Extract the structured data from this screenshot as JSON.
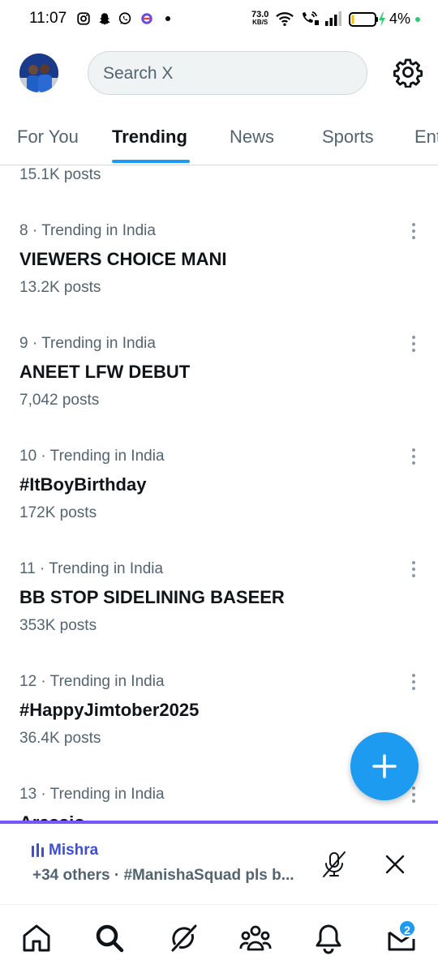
{
  "status_bar": {
    "time": "11:07",
    "net_speed_value": "73.0",
    "net_speed_unit": "KB/S",
    "battery": "4%",
    "notification_icons": [
      "instagram-icon",
      "snapchat-icon",
      "whatsapp-icon",
      "app-icon"
    ]
  },
  "header": {
    "search_placeholder": "Search X"
  },
  "tabs": [
    {
      "label": "For You",
      "active": false
    },
    {
      "label": "Trending",
      "active": true
    },
    {
      "label": "News",
      "active": false
    },
    {
      "label": "Sports",
      "active": false
    },
    {
      "label": "Ent",
      "active": false
    }
  ],
  "partial_top_posts": "15.1K posts",
  "trends": [
    {
      "meta": "8 · Trending in India",
      "title": "VIEWERS CHOICE MANI",
      "posts": "13.2K posts"
    },
    {
      "meta": "9 · Trending in India",
      "title": "ANEET LFW DEBUT",
      "posts": "7,042 posts"
    },
    {
      "meta": "10 · Trending in India",
      "title": "#ItBoyBirthday",
      "posts": "172K posts"
    },
    {
      "meta": "11 · Trending in India",
      "title": "BB STOP SIDELINING BASEER",
      "posts": "353K posts"
    },
    {
      "meta": "12 · Trending in India",
      "title": "#HappyJimtober2025",
      "posts": "36.4K posts"
    },
    {
      "meta": "13 · Trending in India",
      "title": "Arassio",
      "posts": ""
    }
  ],
  "space": {
    "host": "Mishra",
    "subtitle": "+34 others · #ManishaSquad pls b..."
  },
  "bottom_nav": {
    "items": [
      "home-icon",
      "search-icon",
      "grok-icon",
      "communities-icon",
      "notifications-icon",
      "messages-icon"
    ],
    "messages_badge": "2"
  },
  "colors": {
    "accent": "#1d9bf0",
    "spaces_purple": "#7856ff",
    "secondary_text": "#536471",
    "primary_text": "#0f1419"
  }
}
